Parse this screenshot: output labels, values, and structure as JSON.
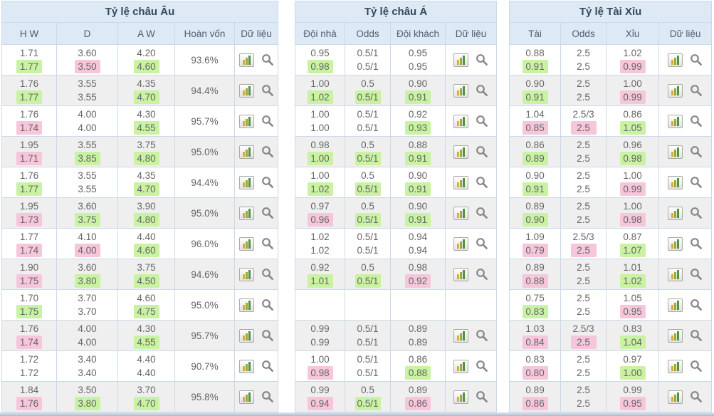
{
  "colors": {
    "header_bg": "#dde9f5",
    "border": "#ccd9e8",
    "row_alt_bg": "#efefef",
    "highlight_up_green": "#c9f2a2",
    "highlight_down_pink": "#f6c6db",
    "text": "#666666",
    "title_text": "#36495c"
  },
  "icons": {
    "bar_chart": "bar-chart-icon",
    "search": "search-icon"
  },
  "tables": [
    {
      "id": "european",
      "title": "Tỷ lệ châu Âu",
      "headers": [
        "H W",
        "D",
        "A W",
        "Hoàn vốn",
        "Dữ liệu"
      ],
      "has_percent": true,
      "rows": [
        {
          "cells": [
            [
              "1.71",
              "1.77",
              "",
              "g"
            ],
            [
              "3.60",
              "3.50",
              "",
              "p"
            ],
            [
              "4.20",
              "4.60",
              "",
              "g"
            ]
          ],
          "pct": "93.6%",
          "icons": true
        },
        {
          "cells": [
            [
              "1.76",
              "1.77",
              "",
              "g"
            ],
            [
              "3.55",
              "3.55",
              "",
              ""
            ],
            [
              "4.35",
              "4.70",
              "",
              "g"
            ]
          ],
          "pct": "94.4%",
          "icons": true
        },
        {
          "cells": [
            [
              "1.76",
              "1.74",
              "",
              "p"
            ],
            [
              "4.00",
              "4.00",
              "",
              ""
            ],
            [
              "4.30",
              "4.55",
              "",
              "g"
            ]
          ],
          "pct": "95.7%",
          "icons": true
        },
        {
          "cells": [
            [
              "1.95",
              "1.71",
              "",
              "p"
            ],
            [
              "3.55",
              "3.85",
              "",
              "g"
            ],
            [
              "3.75",
              "4.80",
              "",
              "g"
            ]
          ],
          "pct": "95.0%",
          "icons": true
        },
        {
          "cells": [
            [
              "1.76",
              "1.77",
              "",
              "g"
            ],
            [
              "3.55",
              "3.55",
              "",
              ""
            ],
            [
              "4.35",
              "4.70",
              "",
              "g"
            ]
          ],
          "pct": "94.4%",
          "icons": true
        },
        {
          "cells": [
            [
              "1.95",
              "1.73",
              "",
              "p"
            ],
            [
              "3.60",
              "3.75",
              "",
              "g"
            ],
            [
              "3.90",
              "4.80",
              "",
              "g"
            ]
          ],
          "pct": "95.0%",
          "icons": true
        },
        {
          "cells": [
            [
              "1.77",
              "1.74",
              "",
              "p"
            ],
            [
              "4.10",
              "4.00",
              "",
              "p"
            ],
            [
              "4.40",
              "4.60",
              "",
              "g"
            ]
          ],
          "pct": "96.0%",
          "icons": true
        },
        {
          "cells": [
            [
              "1.90",
              "1.75",
              "",
              "p"
            ],
            [
              "3.60",
              "3.80",
              "",
              "g"
            ],
            [
              "3.75",
              "4.50",
              "",
              "g"
            ]
          ],
          "pct": "94.6%",
          "icons": true
        },
        {
          "cells": [
            [
              "1.70",
              "1.75",
              "",
              "g"
            ],
            [
              "3.70",
              "3.70",
              "",
              ""
            ],
            [
              "4.60",
              "4.75",
              "",
              "g"
            ]
          ],
          "pct": "95.0%",
          "icons": true
        },
        {
          "cells": [
            [
              "1.76",
              "1.74",
              "",
              "p"
            ],
            [
              "4.00",
              "4.00",
              "",
              ""
            ],
            [
              "4.30",
              "4.55",
              "",
              "g"
            ]
          ],
          "pct": "95.7%",
          "icons": true
        },
        {
          "cells": [
            [
              "1.72",
              "1.72",
              "",
              ""
            ],
            [
              "3.40",
              "3.40",
              "",
              ""
            ],
            [
              "4.40",
              "4.40",
              "",
              ""
            ]
          ],
          "pct": "90.7%",
          "icons": true
        },
        {
          "cells": [
            [
              "1.84",
              "1.76",
              "",
              "p"
            ],
            [
              "3.50",
              "3.80",
              "",
              "g"
            ],
            [
              "3.70",
              "4.70",
              "",
              "g"
            ]
          ],
          "pct": "95.8%",
          "icons": true
        }
      ]
    },
    {
      "id": "asian",
      "title": "Tỷ lệ châu Á",
      "headers": [
        "Đội nhà",
        "Odds",
        "Đội khách",
        "Dữ liệu"
      ],
      "has_percent": false,
      "rows": [
        {
          "cells": [
            [
              "0.95",
              "0.98",
              "",
              "g"
            ],
            [
              "0.5/1",
              "0.5/1",
              "",
              ""
            ],
            [
              "0.95",
              "0.95",
              "",
              ""
            ]
          ],
          "icons": true
        },
        {
          "cells": [
            [
              "1.00",
              "1.02",
              "",
              "g"
            ],
            [
              "0.5",
              "0.5/1",
              "",
              "g"
            ],
            [
              "0.90",
              "0.91",
              "",
              "g"
            ]
          ],
          "icons": true
        },
        {
          "cells": [
            [
              "1.00",
              "1.00",
              "",
              ""
            ],
            [
              "0.5/1",
              "0.5/1",
              "",
              ""
            ],
            [
              "0.92",
              "0.93",
              "",
              "g"
            ]
          ],
          "icons": true
        },
        {
          "cells": [
            [
              "0.98",
              "1.00",
              "",
              "g"
            ],
            [
              "0.5",
              "0.5/1",
              "",
              "g"
            ],
            [
              "0.88",
              "0.91",
              "",
              "g"
            ]
          ],
          "icons": true
        },
        {
          "cells": [
            [
              "1.00",
              "1.02",
              "",
              "g"
            ],
            [
              "0.5",
              "0.5/1",
              "",
              "g"
            ],
            [
              "0.90",
              "0.91",
              "",
              "g"
            ]
          ],
          "icons": true
        },
        {
          "cells": [
            [
              "0.97",
              "0.96",
              "",
              "p"
            ],
            [
              "0.5",
              "0.5/1",
              "",
              "g"
            ],
            [
              "0.90",
              "0.91",
              "",
              "g"
            ]
          ],
          "icons": true
        },
        {
          "cells": [
            [
              "1.02",
              "1.02",
              "",
              ""
            ],
            [
              "0.5/1",
              "0.5/1",
              "",
              ""
            ],
            [
              "0.94",
              "0.94",
              "",
              ""
            ]
          ],
          "icons": true
        },
        {
          "cells": [
            [
              "0.92",
              "1.01",
              "",
              "g"
            ],
            [
              "0.5",
              "0.5/1",
              "",
              "g"
            ],
            [
              "0.98",
              "0.92",
              "",
              "p"
            ]
          ],
          "icons": true
        },
        {
          "cells": [
            [
              "",
              "",
              "",
              ""
            ],
            [
              "",
              "",
              "",
              ""
            ],
            [
              "",
              "",
              "",
              ""
            ]
          ],
          "icons": false
        },
        {
          "cells": [
            [
              "0.99",
              "0.99",
              "",
              ""
            ],
            [
              "0.5/1",
              "0.5/1",
              "",
              ""
            ],
            [
              "0.89",
              "0.89",
              "",
              ""
            ]
          ],
          "icons": true
        },
        {
          "cells": [
            [
              "1.00",
              "0.98",
              "",
              "p"
            ],
            [
              "0.5/1",
              "0.5/1",
              "",
              ""
            ],
            [
              "0.86",
              "0.88",
              "",
              "g"
            ]
          ],
          "icons": true
        },
        {
          "cells": [
            [
              "0.99",
              "0.94",
              "",
              "p"
            ],
            [
              "0.5",
              "0.5/1",
              "",
              "g"
            ],
            [
              "0.89",
              "0.86",
              "",
              "p"
            ]
          ],
          "icons": true
        }
      ]
    },
    {
      "id": "over-under",
      "title": "Tỷ lệ Tài Xỉu",
      "headers": [
        "Tài",
        "Odds",
        "Xỉu",
        "Dữ liệu"
      ],
      "has_percent": false,
      "rows": [
        {
          "cells": [
            [
              "0.88",
              "0.91",
              "",
              "g"
            ],
            [
              "2.5",
              "2.5",
              "",
              ""
            ],
            [
              "1.02",
              "0.99",
              "",
              "p"
            ]
          ],
          "icons": true
        },
        {
          "cells": [
            [
              "0.90",
              "0.91",
              "",
              "g"
            ],
            [
              "2.5",
              "2.5",
              "",
              ""
            ],
            [
              "1.00",
              "0.99",
              "",
              "p"
            ]
          ],
          "icons": true
        },
        {
          "cells": [
            [
              "1.04",
              "0.85",
              "",
              "p"
            ],
            [
              "2.5/3",
              "2.5",
              "",
              "p"
            ],
            [
              "0.86",
              "1.05",
              "",
              "g"
            ]
          ],
          "icons": true
        },
        {
          "cells": [
            [
              "0.86",
              "0.89",
              "",
              "g"
            ],
            [
              "2.5",
              "2.5",
              "",
              ""
            ],
            [
              "0.96",
              "0.98",
              "",
              "g"
            ]
          ],
          "icons": true
        },
        {
          "cells": [
            [
              "0.90",
              "0.91",
              "",
              "g"
            ],
            [
              "2.5",
              "2.5",
              "",
              ""
            ],
            [
              "1.00",
              "0.99",
              "",
              "p"
            ]
          ],
          "icons": true
        },
        {
          "cells": [
            [
              "0.89",
              "0.90",
              "",
              "g"
            ],
            [
              "2.5",
              "2.5",
              "",
              ""
            ],
            [
              "1.00",
              "0.98",
              "",
              "p"
            ]
          ],
          "icons": true
        },
        {
          "cells": [
            [
              "1.09",
              "0.79",
              "",
              "p"
            ],
            [
              "2.5/3",
              "2.5",
              "",
              "p"
            ],
            [
              "0.87",
              "1.07",
              "",
              "g"
            ]
          ],
          "icons": true
        },
        {
          "cells": [
            [
              "0.89",
              "0.88",
              "",
              "p"
            ],
            [
              "2.5",
              "2.5",
              "",
              ""
            ],
            [
              "1.01",
              "1.02",
              "",
              "g"
            ]
          ],
          "icons": true
        },
        {
          "cells": [
            [
              "0.75",
              "0.83",
              "",
              "g"
            ],
            [
              "2.5",
              "2.5",
              "",
              ""
            ],
            [
              "1.05",
              "0.95",
              "",
              "p"
            ]
          ],
          "icons": true
        },
        {
          "cells": [
            [
              "1.03",
              "0.84",
              "",
              "p"
            ],
            [
              "2.5/3",
              "2.5",
              "",
              "p"
            ],
            [
              "0.83",
              "1.04",
              "",
              "g"
            ]
          ],
          "icons": true
        },
        {
          "cells": [
            [
              "0.83",
              "0.80",
              "",
              "p"
            ],
            [
              "2.5",
              "2.5",
              "",
              ""
            ],
            [
              "0.97",
              "1.00",
              "",
              "g"
            ]
          ],
          "icons": true
        },
        {
          "cells": [
            [
              "0.89",
              "0.86",
              "",
              "p"
            ],
            [
              "2.5",
              "2.5",
              "",
              ""
            ],
            [
              "0.99",
              "0.95",
              "",
              "p"
            ]
          ],
          "icons": true
        }
      ]
    }
  ]
}
